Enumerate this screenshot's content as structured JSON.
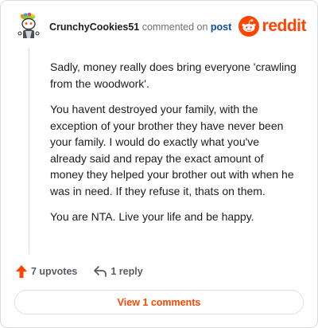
{
  "header": {
    "username": "CrunchyCookies51",
    "commented_text": "commented on",
    "post_link": "post",
    "brand": "reddit"
  },
  "comment": {
    "paragraphs": [
      "Sadly, money really does bring everyone 'crawling from the woodwork'.",
      "You havent destroyed your family, with the exception of your brother they have never been your family. I would do exactly what you've already said and repay the exact amount of money they helped your brother out with when he was in need. If they refuse it, thats on them.",
      "You are NTA. Live your life and be happy."
    ]
  },
  "actions": {
    "upvotes": "7 upvotes",
    "reply": "1 reply"
  },
  "footer": {
    "view_comments": "View 1 comments"
  },
  "colors": {
    "accent": "#ff4500",
    "link": "#0a4ea3"
  },
  "icons": {
    "upvote": "upvote-arrow-icon",
    "reply": "reply-arrow-icon",
    "logo": "reddit-snoo-icon"
  }
}
